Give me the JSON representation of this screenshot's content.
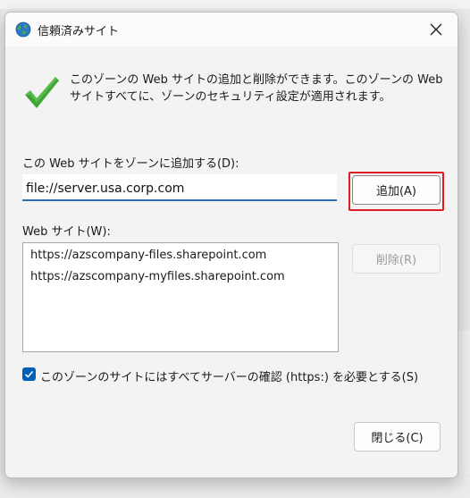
{
  "window": {
    "title": "信頼済みサイト",
    "icon": "globe-icon"
  },
  "info": {
    "icon": "checkmark-icon",
    "text": "このゾーンの Web サイトの追加と削除ができます。このゾーンの Web サイトすべてに、ゾーンのセキュリティ設定が適用されます。"
  },
  "add_section": {
    "label": "この Web サイトをゾーンに追加する(D):",
    "input_value": "file://server.usa.corp.com",
    "add_button": "追加(A)"
  },
  "sites_section": {
    "label": "Web サイト(W):",
    "items": [
      "https://azscompany-files.sharepoint.com",
      "https://azscompany-myfiles.sharepoint.com"
    ],
    "remove_button": "削除(R)"
  },
  "https_option": {
    "checked": true,
    "label": "このゾーンのサイトにはすべてサーバーの確認 (https:) を必要とする(S)"
  },
  "footer": {
    "close_button": "閉じる(C)"
  },
  "colors": {
    "accent": "#005fb8",
    "highlight": "#e01b24",
    "check_green": "#3fa535"
  }
}
